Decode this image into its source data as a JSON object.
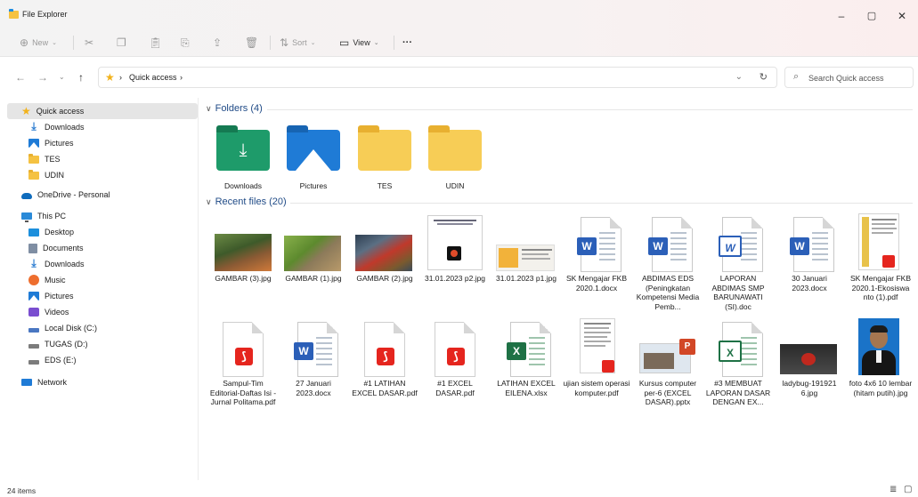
{
  "window": {
    "title": "File Explorer",
    "controls": {
      "minimize": "–",
      "maximize": "▢",
      "close": "✕"
    }
  },
  "toolbar": {
    "new_label": "New",
    "sort_label": "Sort",
    "view_label": "View",
    "more_label": "···"
  },
  "address": {
    "crumbs": [
      "Quick access"
    ],
    "search_placeholder": "Search Quick access"
  },
  "sidebar": {
    "items": [
      {
        "label": "Quick access",
        "icon": "star-icon",
        "selected": true
      },
      {
        "label": "Downloads",
        "icon": "download-icon"
      },
      {
        "label": "Pictures",
        "icon": "pictures-icon"
      },
      {
        "label": "TES",
        "icon": "folder-icon"
      },
      {
        "label": "UDIN",
        "icon": "folder-icon"
      },
      {
        "label": "OneDrive - Personal",
        "icon": "cloud-icon"
      },
      {
        "label": "This PC",
        "icon": "pc-icon"
      },
      {
        "label": "Desktop",
        "icon": "desktop-icon"
      },
      {
        "label": "Documents",
        "icon": "documents-icon"
      },
      {
        "label": "Downloads",
        "icon": "download-icon"
      },
      {
        "label": "Music",
        "icon": "music-icon"
      },
      {
        "label": "Pictures",
        "icon": "pictures-icon"
      },
      {
        "label": "Videos",
        "icon": "videos-icon"
      },
      {
        "label": "Local Disk (C:)",
        "icon": "drive-icon"
      },
      {
        "label": "TUGAS (D:)",
        "icon": "drive-icon"
      },
      {
        "label": "EDS (E:)",
        "icon": "drive-icon"
      },
      {
        "label": "Network",
        "icon": "network-icon"
      }
    ]
  },
  "folders": {
    "header": "Folders (4)",
    "items": [
      {
        "label": "Downloads",
        "color": "#1e9b6a"
      },
      {
        "label": "Pictures",
        "color": "#1f7bd6"
      },
      {
        "label": "TES",
        "color": "#f5c242"
      },
      {
        "label": "UDIN",
        "color": "#f5c242"
      }
    ]
  },
  "recent": {
    "header": "Recent files (20)",
    "row1": [
      {
        "label": "GAMBAR (3).jpg",
        "kind": "photo-squirrel"
      },
      {
        "label": "GAMBAR (1).jpg",
        "kind": "photo-cat"
      },
      {
        "label": "GAMBAR (2).jpg",
        "kind": "photo-rooster"
      },
      {
        "label": "31.01.2023 p2.jpg",
        "kind": "photo-slide"
      },
      {
        "label": "31.01.2023 p1.jpg",
        "kind": "photo-web"
      },
      {
        "label": "SK Mengajar FKB 2020.1.docx",
        "kind": "word"
      },
      {
        "label": "ABDIMAS EDS (Peningkatan Kompetensi Media Pemb...",
        "kind": "word"
      },
      {
        "label": "LAPORAN ABDIMAS SMP BARUNAWATI (SI).doc",
        "kind": "word-old"
      },
      {
        "label": "30 Januari 2023.docx",
        "kind": "word"
      },
      {
        "label": "SK Mengajar FKB 2020.1-Ekosiswa nto (1).pdf",
        "kind": "pdf-thumb"
      }
    ],
    "row2": [
      {
        "label": "Sampul-Tim Editorial-Daftas Isi - Jurnal Politama.pdf",
        "kind": "pdf"
      },
      {
        "label": "27 Januari 2023.docx",
        "kind": "word"
      },
      {
        "label": "#1 LATIHAN EXCEL DASAR.pdf",
        "kind": "pdf"
      },
      {
        "label": "#1 EXCEL DASAR.pdf",
        "kind": "pdf"
      },
      {
        "label": "LATIHAN EXCEL EILENA.xlsx",
        "kind": "excel"
      },
      {
        "label": "ujian sistem operasi komputer.pdf",
        "kind": "pdf-thumb2"
      },
      {
        "label": "Kursus computer per-6 (EXCEL DASAR).pptx",
        "kind": "ppt"
      },
      {
        "label": "#3 MEMBUAT LAPORAN DASAR DENGAN EX...",
        "kind": "excel-old"
      },
      {
        "label": "ladybug-191921 6.jpg",
        "kind": "photo-ladybug"
      },
      {
        "label": "foto 4x6 10 lembar (hitam putih).jpg",
        "kind": "photo-portrait"
      }
    ]
  },
  "status": {
    "count": "24 items"
  }
}
